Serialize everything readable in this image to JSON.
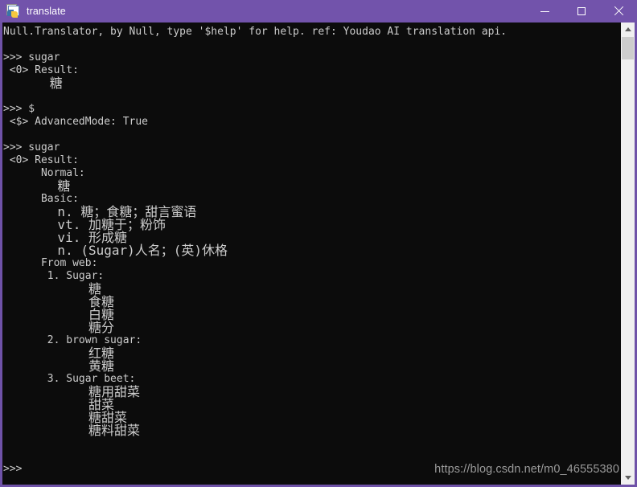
{
  "window": {
    "title": "translate",
    "icon": "python-script-icon",
    "controls": {
      "minimize": "minimize-icon",
      "maximize": "maximize-icon",
      "close": "close-icon"
    },
    "titlebar_color": "#7253ab",
    "console_background": "#0c0c0c",
    "console_text_color": "#cccccc"
  },
  "console": {
    "lines": [
      {
        "text": "Null.Translator, by Null, type '$help' for help. ref: Youdao AI translation api.",
        "cjk": false
      },
      {
        "text": "",
        "cjk": false
      },
      {
        "text": ">>> sugar",
        "cjk": false
      },
      {
        "text": " <0> Result:",
        "cjk": false
      },
      {
        "text": "      糖",
        "cjk": true
      },
      {
        "text": "",
        "cjk": false
      },
      {
        "text": ">>> $",
        "cjk": false
      },
      {
        "text": " <$> AdvancedMode: True",
        "cjk": false
      },
      {
        "text": "",
        "cjk": false
      },
      {
        "text": ">>> sugar",
        "cjk": false
      },
      {
        "text": " <0> Result:",
        "cjk": false
      },
      {
        "text": "      Normal:",
        "cjk": false
      },
      {
        "text": "       糖",
        "cjk": true
      },
      {
        "text": "      Basic:",
        "cjk": false
      },
      {
        "text": "       n. 糖；食糖；甜言蜜语",
        "cjk": true
      },
      {
        "text": "       vt. 加糖于；粉饰",
        "cjk": true
      },
      {
        "text": "       vi. 形成糖",
        "cjk": true
      },
      {
        "text": "       n. (Sugar)人名；(英)休格",
        "cjk": true
      },
      {
        "text": "      From web:",
        "cjk": false
      },
      {
        "text": "       1. Sugar:",
        "cjk": false
      },
      {
        "text": "           糖",
        "cjk": true
      },
      {
        "text": "           食糖",
        "cjk": true
      },
      {
        "text": "           白糖",
        "cjk": true
      },
      {
        "text": "           糖分",
        "cjk": true
      },
      {
        "text": "       2. brown sugar:",
        "cjk": false
      },
      {
        "text": "           红糖",
        "cjk": true
      },
      {
        "text": "           黄糖",
        "cjk": true
      },
      {
        "text": "       3. Sugar beet:",
        "cjk": false
      },
      {
        "text": "           糖用甜菜",
        "cjk": true
      },
      {
        "text": "           甜菜",
        "cjk": true
      },
      {
        "text": "           糖甜菜",
        "cjk": true
      },
      {
        "text": "           糖料甜菜",
        "cjk": true
      },
      {
        "text": "",
        "cjk": false
      },
      {
        "text": "",
        "cjk": false
      },
      {
        "text": ">>>",
        "cjk": false
      }
    ]
  },
  "scrollbar": {
    "up_arrow": "chevron-up-icon",
    "down_arrow": "chevron-down-icon",
    "thumb": "scrollbar-thumb"
  },
  "watermark": {
    "text": "https://blog.csdn.net/m0_46555380"
  }
}
